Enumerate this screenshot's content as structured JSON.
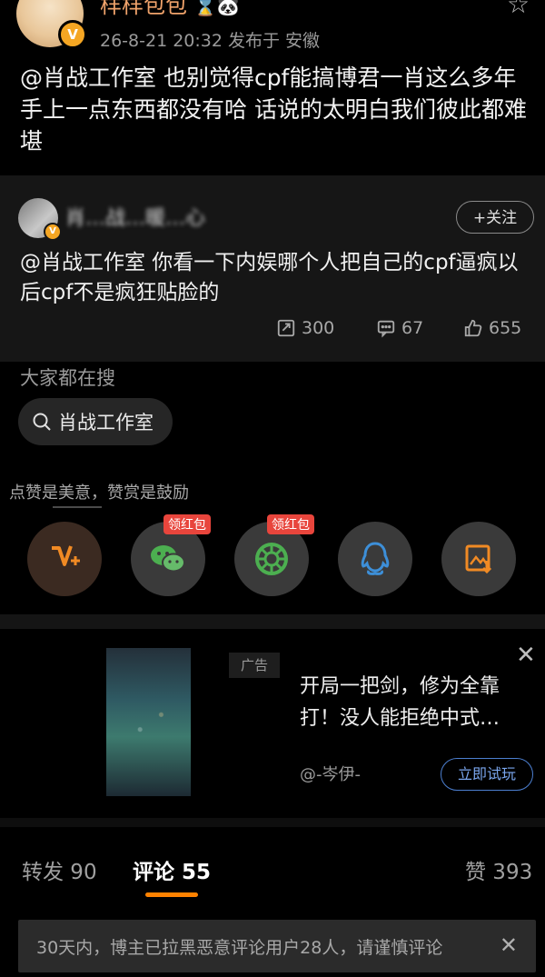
{
  "post": {
    "username": "样样包包",
    "username_emojis": "⌛🐼",
    "meta": "26-8-21 20:32  发布于 安徽",
    "text": "@肖战工作室 也别觉得cpf能搞博君一肖这么多年手上一点东西都没有哈 话说的太明白我们彼此都难堪"
  },
  "retweet": {
    "name": "肖…战…暖…心",
    "follow_label": "+关注",
    "text": "@肖战工作室 你看一下内娱哪个人把自己的cpf逼疯以后cpf不是疯狂贴脸的",
    "stats": {
      "reposts": "300",
      "comments": "67",
      "likes": "655"
    }
  },
  "search": {
    "title": "大家都在搜",
    "chip": "肖战工作室"
  },
  "share": {
    "title": "点赞是美意，赞赏是鼓励",
    "redpacket_label": "领红包",
    "icons": [
      "like-icon",
      "wechat-icon",
      "moments-icon",
      "qq-icon",
      "save-image-icon"
    ]
  },
  "ad": {
    "tag": "广告",
    "title": "开局一把剑，修为全靠打！没人能拒绝中式…",
    "author": "@-岑伊-",
    "cta": "立即试玩"
  },
  "tabs": {
    "repost": "转发 90",
    "comments": "评论 55",
    "likes": "赞 393"
  },
  "notice": {
    "text": "30天内，博主已拉黑恶意评论用户28人，请谨慎评论"
  },
  "colors": {
    "accent": "#ff8200",
    "username": "#f0a36b",
    "badge": "#f5a623",
    "redpacket": "#e8453c",
    "wechat_green": "#4caf50",
    "qq_blue": "#3d8fd8"
  }
}
